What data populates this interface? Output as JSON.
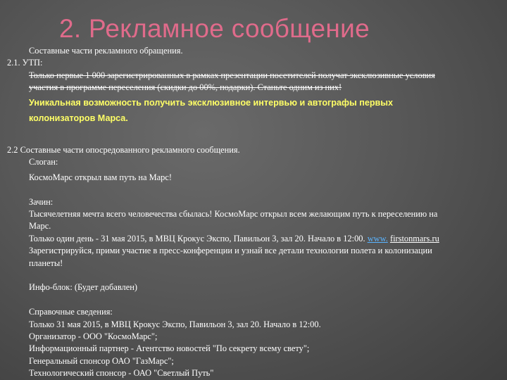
{
  "slide": {
    "title": "2. Рекламное сообщение",
    "s1_heading": "Составные части рекламного обращения.",
    "s1_label": "2.1. УТП:",
    "utp_line1": "Только первые 1 000 зарегистрированных в рамках презентации посетителей получат эксклюзивные условия",
    "utp_line2": "участия в программе переселения (скидки до 00%, подарки). Станьте одним из них!",
    "highlight_line1": "Уникальная возможность получить эксклюзивное интервью и автографы  первых",
    "highlight_line2": "колонизаторов  Марса.",
    "s2_label": "2.2  Составные части опосредованного рекламного сообщения.",
    "slogan_label": "Слоган:",
    "slogan_text": "КосмоМарс открыл вам путь на Марс!",
    "intro_label": "Зачин:",
    "intro_line1": "Тысячелетняя мечта всего человечества сбылась! КосмоМарс открыл всем желающим путь к переселению на",
    "intro_line2": "Марс.",
    "intro_line3_text": "Только один день - 31 мая 2015, в МВЦ Крокус Экспо, Павильон 3, зал 20. Начало в 12:00.",
    "intro_link_www": "www.",
    "intro_link_domain": "firstonmars.ru",
    "intro_line4": "Зарегистрируйся, прими участие в пресс-конференции и узнай все детали технологии полета и колонизации",
    "intro_line5": "планеты!",
    "info_block": "Инфо-блок: (Будет добавлен)",
    "ref_label": "Справочные сведения:",
    "ref_line1": "Только 31 мая 2015, в МВЦ Крокус Экспо, Павильон 3, зал 20. Начало в 12:00.",
    "ref_line2": "Организатор - ООО \"КосмоМарс\";",
    "ref_line3": "Информационный партнер - Агентство новостей \"По секрету всему свету\";",
    "ref_line4": "Генеральный спонсор ОАО \"ГазМарс\";",
    "ref_line5": "Технологический спонсор - ОАО \"Светлый Путь\""
  }
}
